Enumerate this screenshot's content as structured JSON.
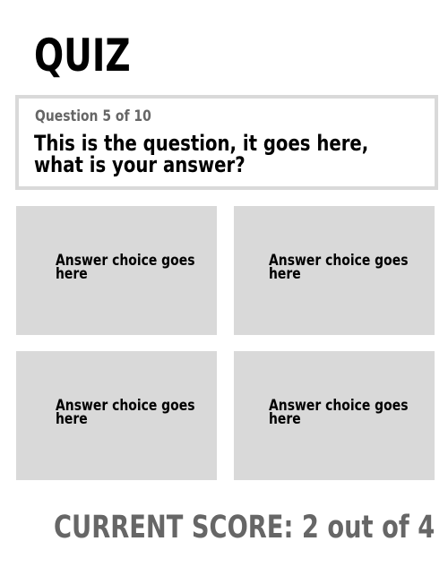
{
  "app": {
    "title": "QUIZ"
  },
  "question": {
    "counter": "Question 5 of 10",
    "text": "This is the question, it goes here, what is your answer?"
  },
  "answers": [
    {
      "label": "Answer choice goes here"
    },
    {
      "label": "Answer choice goes here"
    },
    {
      "label": "Answer choice goes here"
    },
    {
      "label": "Answer choice goes here"
    }
  ],
  "score": {
    "text": "CURRENT SCORE: 2 out of 4"
  },
  "colors": {
    "tile_background": "#d9d9d9",
    "secondary_text": "#666666",
    "primary_text": "#000000"
  }
}
